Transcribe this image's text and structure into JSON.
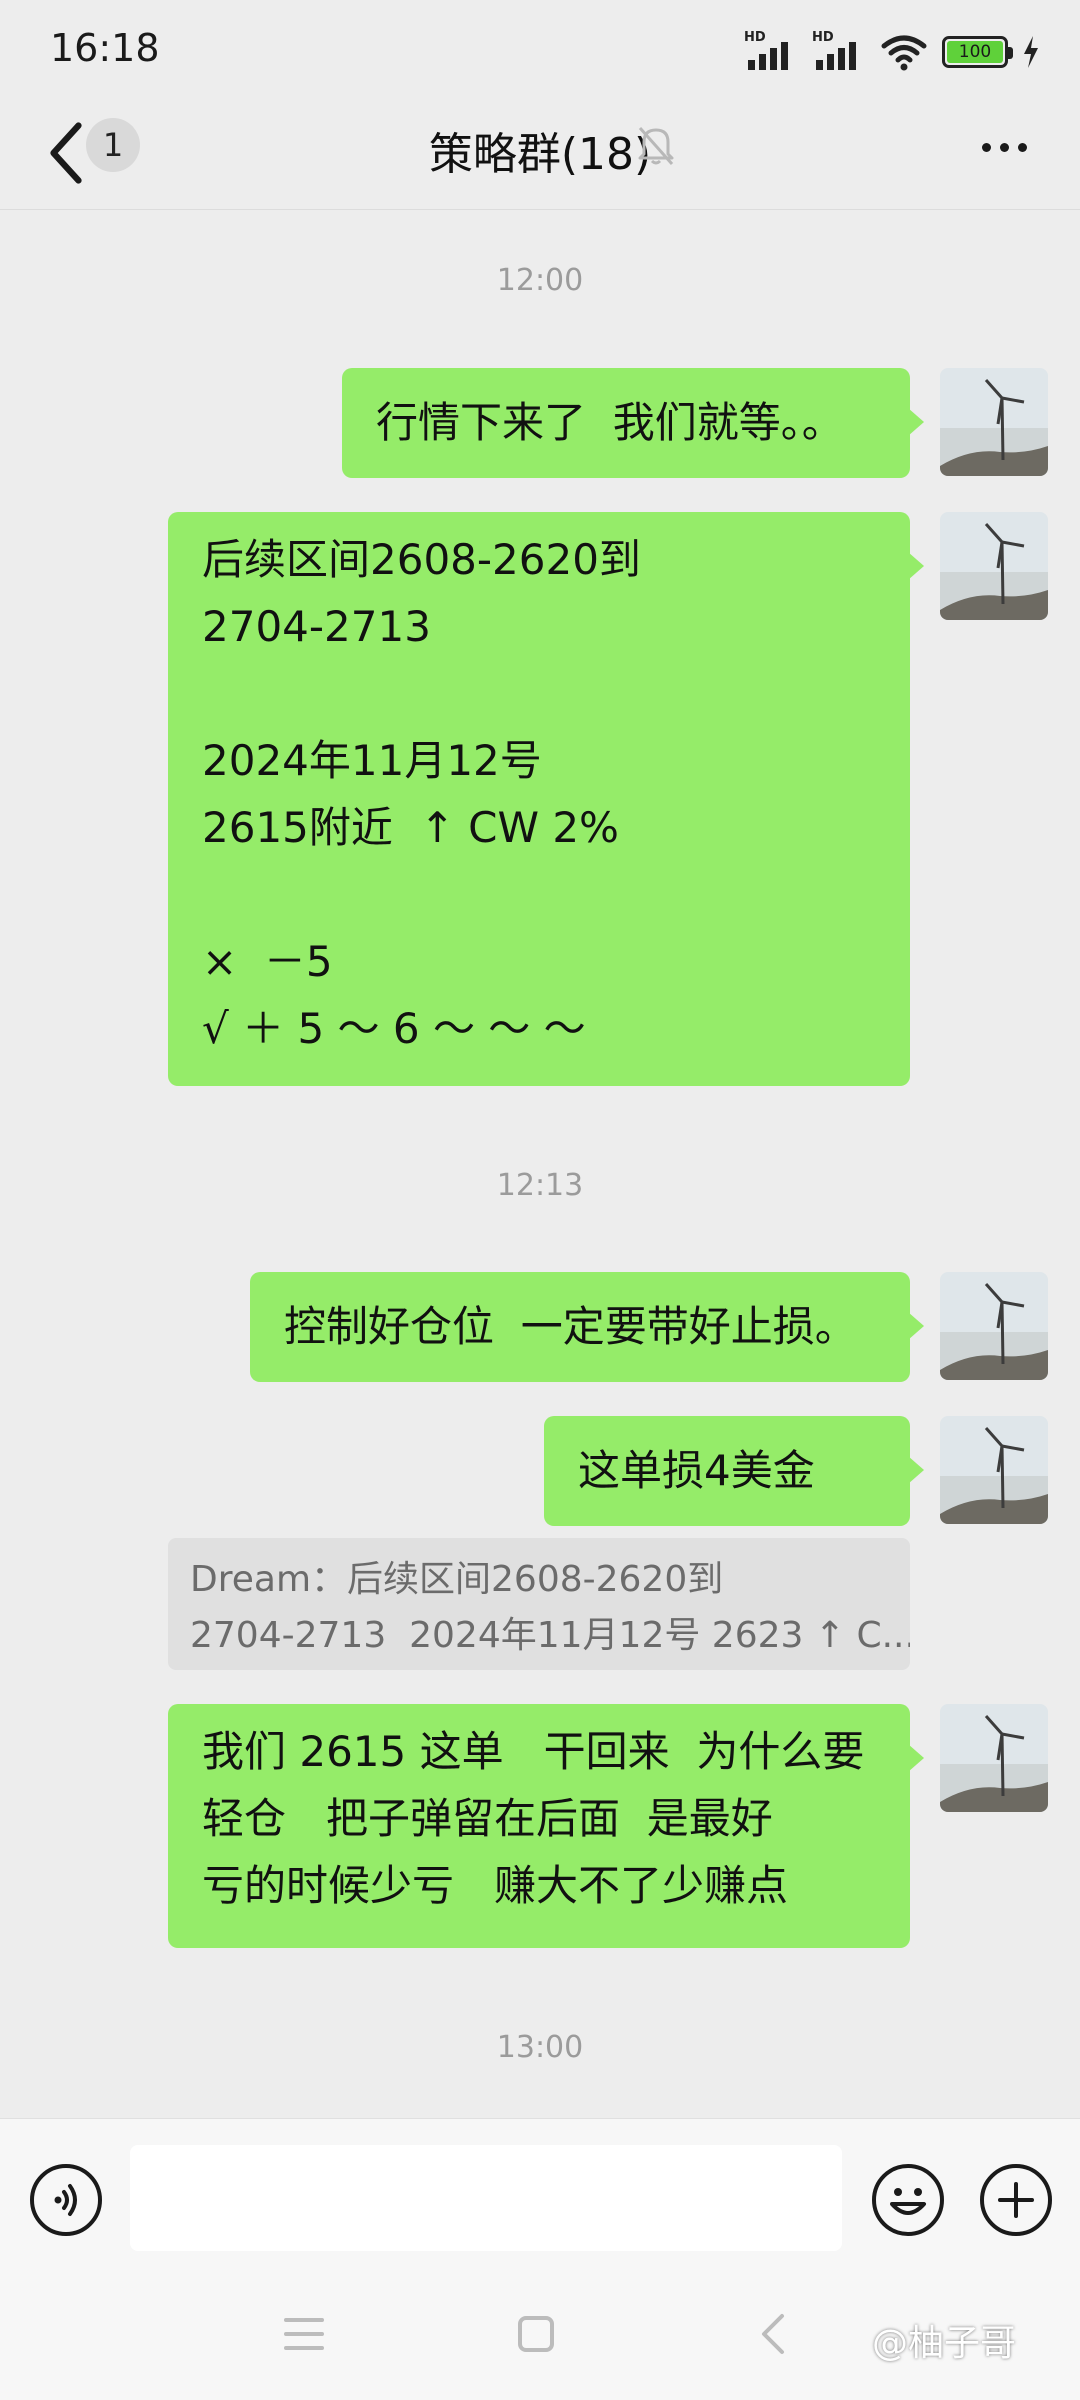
{
  "status": {
    "time": "16:18",
    "signal_label": "HD",
    "battery": "100"
  },
  "header": {
    "back_count": "1",
    "title": "策略群(18)"
  },
  "timestamps": [
    "12:00",
    "12:13",
    "13:00"
  ],
  "messages": [
    {
      "text": "行情下来了  我们就等。。"
    },
    {
      "text": "后续区间2608-2620到\n2704-2713\n\n2024年11月12号\n2615附近  ↑ CW 2%\n\n×  －5\n√ ＋ 5 ～ 6 ～ ～ ～"
    },
    {
      "text": "控制好仓位  一定要带好止损。"
    },
    {
      "text": "这单损4美金"
    },
    {
      "text": "我们 2615 这单   干回来  为什么要\n轻仓   把子弹留在后面  是最好\n亏的时候少亏   赚大不了少赚点"
    }
  ],
  "quote": {
    "text": "Dream：后续区间2608-2620到\n2704-2713  2024年11月12号 2623 ↑ C..."
  },
  "input": {
    "placeholder": ""
  },
  "watermark": "@柚子哥",
  "colors": {
    "bubble": "#95ec69",
    "background": "#ededed",
    "bar": "#f7f7f7"
  },
  "icons": [
    "back-icon",
    "mute-bell-icon",
    "more-icon",
    "voice-icon",
    "emoji-icon",
    "plus-icon"
  ]
}
